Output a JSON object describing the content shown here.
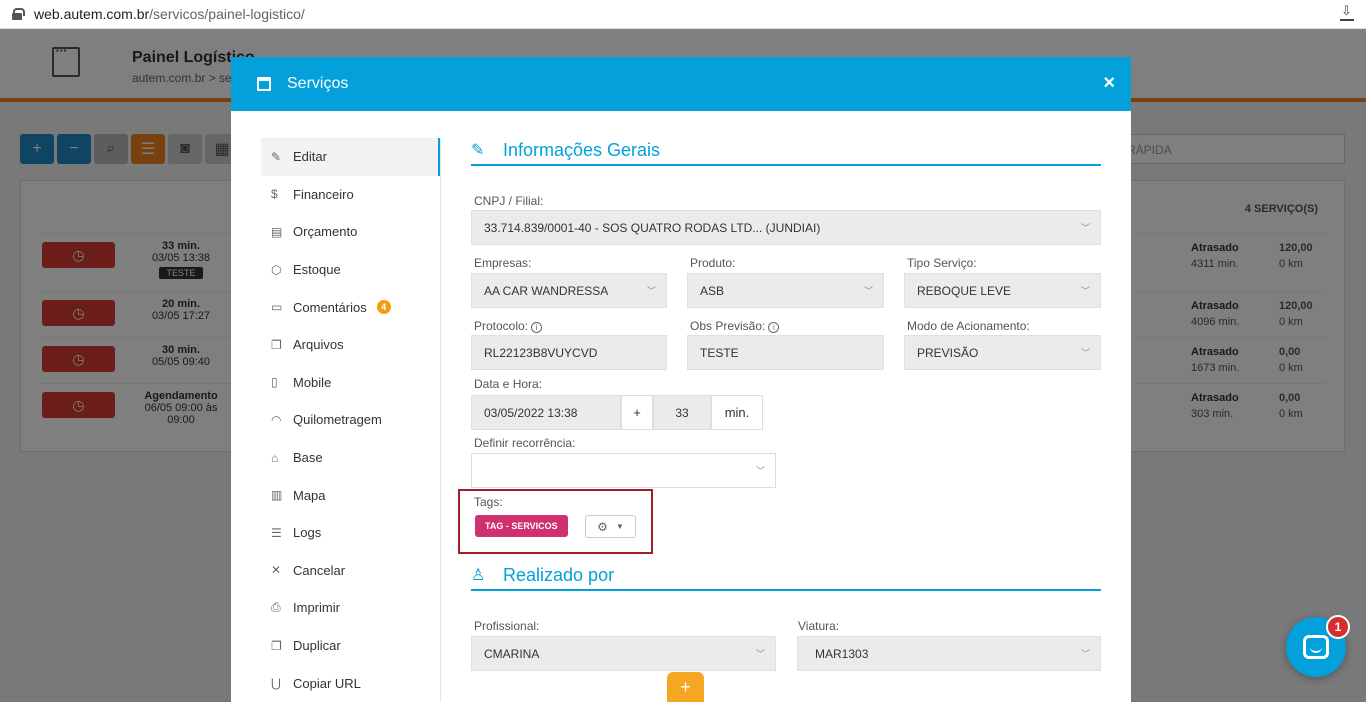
{
  "browser": {
    "url_host": "web.autem.com.br",
    "url_path": "/servicos/painel-logistico/"
  },
  "bg": {
    "title": "Painel Logístico",
    "bread": "autem.com.br  >  se",
    "search_placeholder": "RÁPIDA",
    "count": "4 SERVIÇO(S)",
    "rows": [
      {
        "t1": "33 min.",
        "t2": "03/05 13:38",
        "tag": "TESTE",
        "s1": "Atrasado",
        "s2": "4311 min.",
        "v1": "120,00",
        "v2": "0 km"
      },
      {
        "t1": "20 min.",
        "t2": "03/05 17:27",
        "tag": "",
        "s1": "Atrasado",
        "s2": "4096 min.",
        "v1": "120,00",
        "v2": "0 km"
      },
      {
        "t1": "30 min.",
        "t2": "05/05 09:40",
        "tag": "",
        "s1": "Atrasado",
        "s2": "1673 min.",
        "v1": "0,00",
        "v2": "0 km"
      },
      {
        "t1": "Agendamento",
        "t2": "06/05 09:00 às 09:00",
        "tag": "",
        "s1": "Atrasado",
        "s2": "303 min.",
        "v1": "0,00",
        "v2": "0 km"
      }
    ]
  },
  "modal": {
    "title": "Serviços",
    "close": "×",
    "sidebar": [
      {
        "icon": "✎",
        "label": "Editar"
      },
      {
        "icon": "$",
        "label": "Financeiro"
      },
      {
        "icon": "▤",
        "label": "Orçamento"
      },
      {
        "icon": "⬡",
        "label": "Estoque"
      },
      {
        "icon": "▭",
        "label": "Comentários",
        "badge": "4"
      },
      {
        "icon": "❐",
        "label": "Arquivos"
      },
      {
        "icon": "▯",
        "label": "Mobile"
      },
      {
        "icon": "◠",
        "label": "Quilometragem"
      },
      {
        "icon": "⌂",
        "label": "Base"
      },
      {
        "icon": "▥",
        "label": "Mapa"
      },
      {
        "icon": "☰",
        "label": "Logs"
      },
      {
        "icon": "✕",
        "label": "Cancelar"
      },
      {
        "icon": "⎙",
        "label": "Imprimir"
      },
      {
        "icon": "❐",
        "label": "Duplicar"
      },
      {
        "icon": "⋃",
        "label": "Copiar URL"
      }
    ],
    "sec1_title": "Informações Gerais",
    "sec2_title": "Realizado por",
    "fields": {
      "cnpj_label": "CNPJ / Filial:",
      "cnpj": "33.714.839/0001-40 - SOS QUATRO RODAS LTD... (JUNDIAI)",
      "empresas_label": "Empresas:",
      "empresas": "AA CAR WANDRESSA",
      "produto_label": "Produto:",
      "produto": "ASB",
      "tipo_label": "Tipo Serviço:",
      "tipo": "REBOQUE LEVE",
      "protocolo_label": "Protocolo:",
      "protocolo": "RL22123B8VUYCVD",
      "obs_label": "Obs Previsão:",
      "obs": "TESTE",
      "modo_label": "Modo de Acionamento:",
      "modo": "PREVISÃO",
      "data_label": "Data e Hora:",
      "data": "03/05/2022 13:38",
      "plus": "+",
      "minutes": "33",
      "min_unit": "min.",
      "recorrencia_label": "Definir recorrência:",
      "tags_label": "Tags:",
      "tag": "TAG - SERVICOS",
      "profissional_label": "Profissional:",
      "profissional": "CMARINA",
      "viatura_label": "Viatura:",
      "viatura": "MAR1303"
    },
    "fab": "+"
  },
  "chat_badge": "1"
}
